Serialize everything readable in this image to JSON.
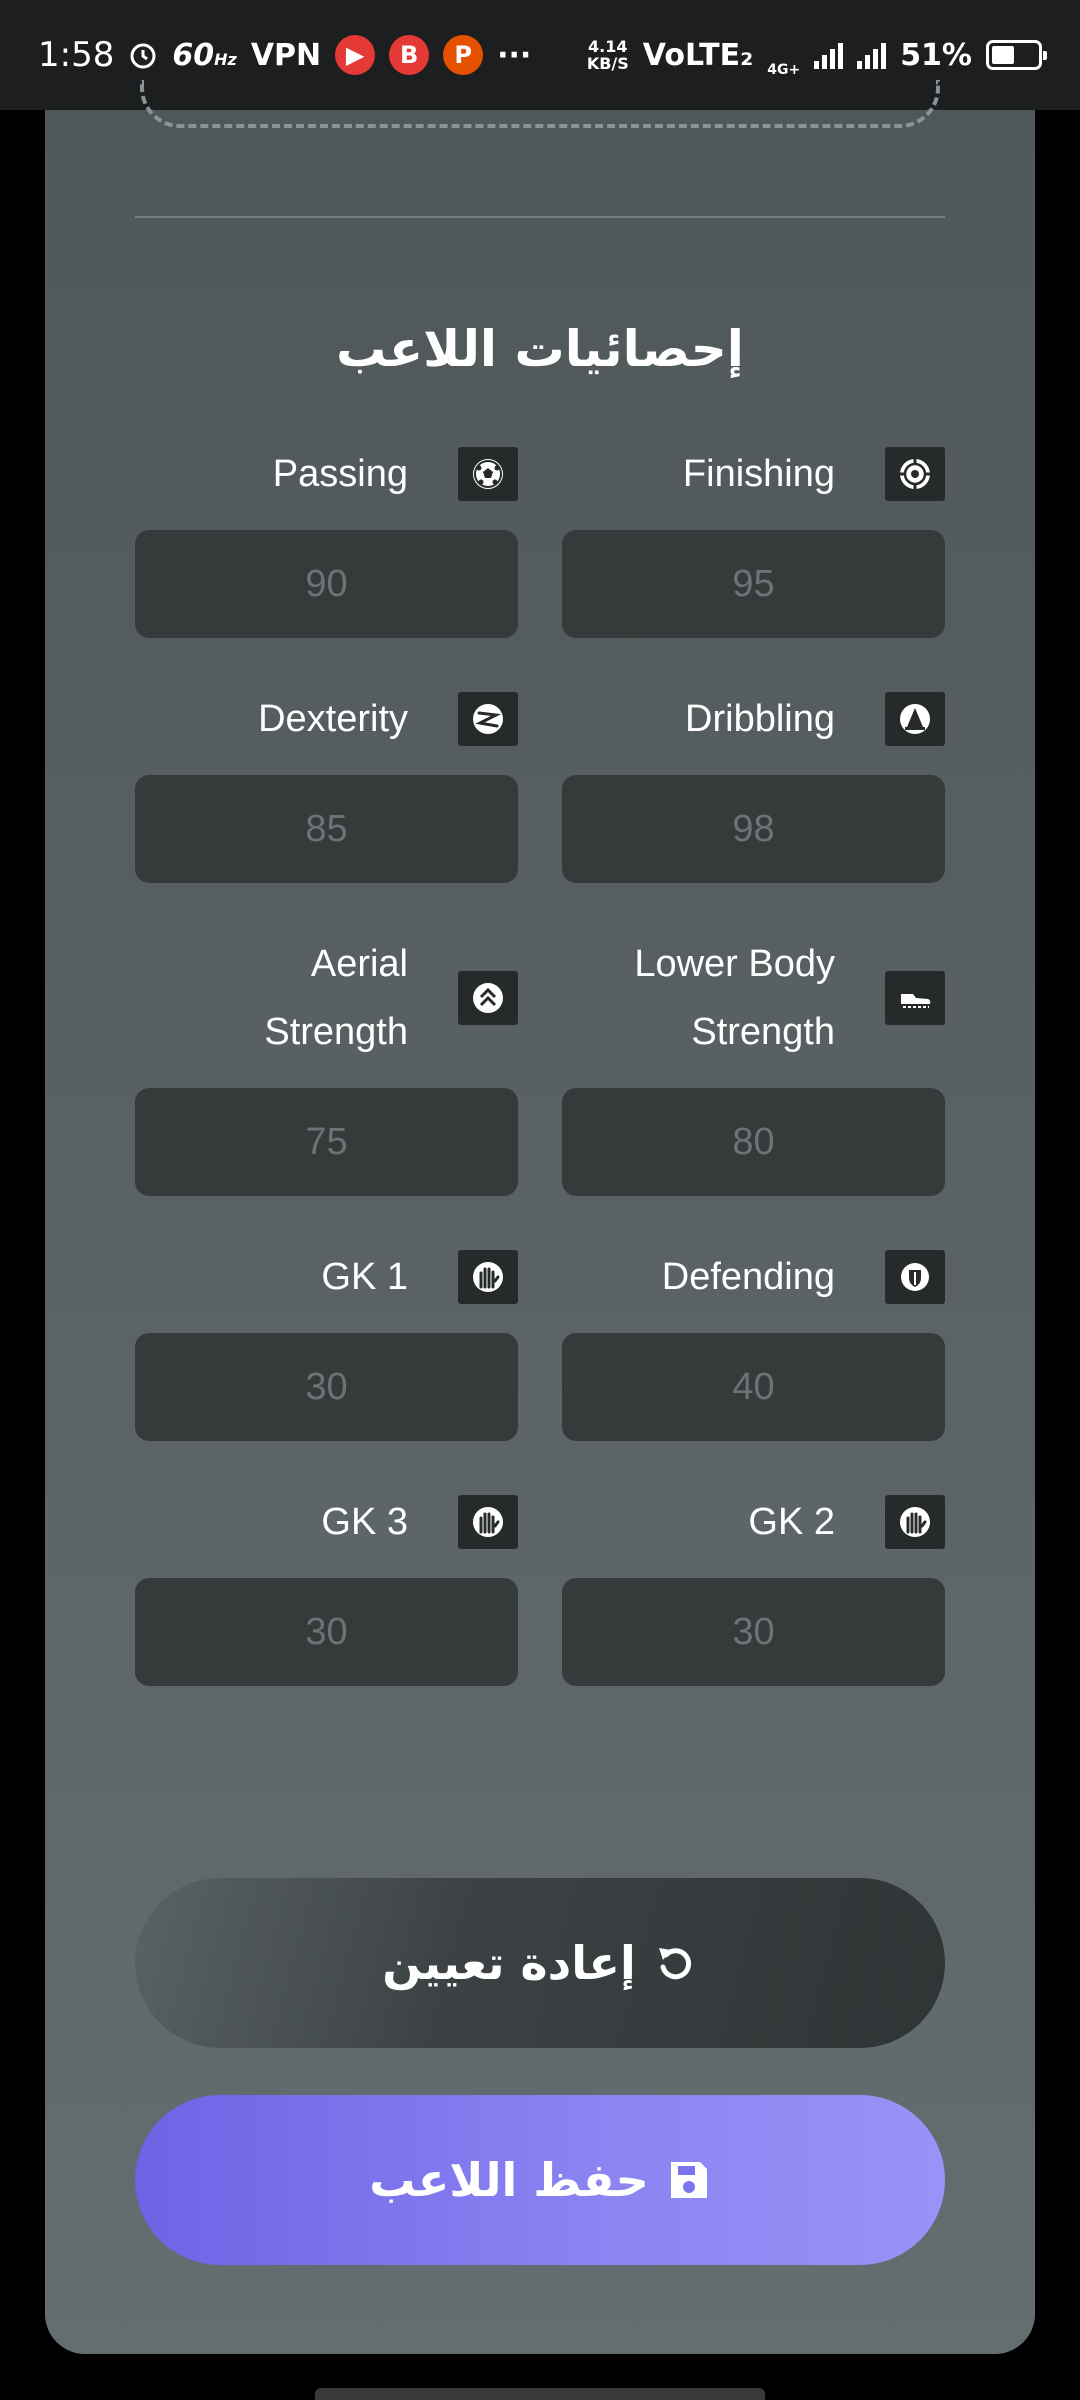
{
  "status_bar": {
    "time": "1:58",
    "hz": "60",
    "hz_unit": "Hz",
    "vpn": "VPN",
    "speed_top": "4.14",
    "speed_bottom": "KB/S",
    "volte": "VoLTE₂",
    "net": "4G+",
    "battery": "51%",
    "battery_level": 0.51,
    "apps": [
      {
        "name": "youtube-icon",
        "glyph": "▶",
        "color": "#e53935"
      },
      {
        "name": "brave-b-icon",
        "glyph": "B",
        "color": "#e53935"
      },
      {
        "name": "p-app-icon",
        "glyph": "P",
        "color": "#e65100"
      }
    ]
  },
  "section": {
    "title": "إحصائيات اللاعب"
  },
  "stats": [
    {
      "label": "Passing",
      "icon": "soccer-ball-icon",
      "placeholder": "90"
    },
    {
      "label": "Finishing",
      "icon": "target-icon",
      "placeholder": "95"
    },
    {
      "label": "Dexterity",
      "icon": "dexterity-icon",
      "placeholder": "85"
    },
    {
      "label": "Dribbling",
      "icon": "cone-icon",
      "placeholder": "98"
    },
    {
      "label": "Aerial Strength",
      "icon": "double-chevron-up-icon",
      "placeholder": "75"
    },
    {
      "label": "Lower Body Strength",
      "icon": "boot-icon",
      "placeholder": "80"
    },
    {
      "label": "GK 1",
      "icon": "goalkeeper-glove-1-icon",
      "placeholder": "30"
    },
    {
      "label": "Defending",
      "icon": "shield-icon",
      "placeholder": "40"
    },
    {
      "label": "GK 3",
      "icon": "goalkeeper-glove-3-icon",
      "placeholder": "30"
    },
    {
      "label": "GK 2",
      "icon": "goalkeeper-glove-2-icon",
      "placeholder": "30"
    }
  ],
  "buttons": {
    "reset_label": "إعادة تعيين",
    "save_label": "حفظ اللاعب"
  }
}
